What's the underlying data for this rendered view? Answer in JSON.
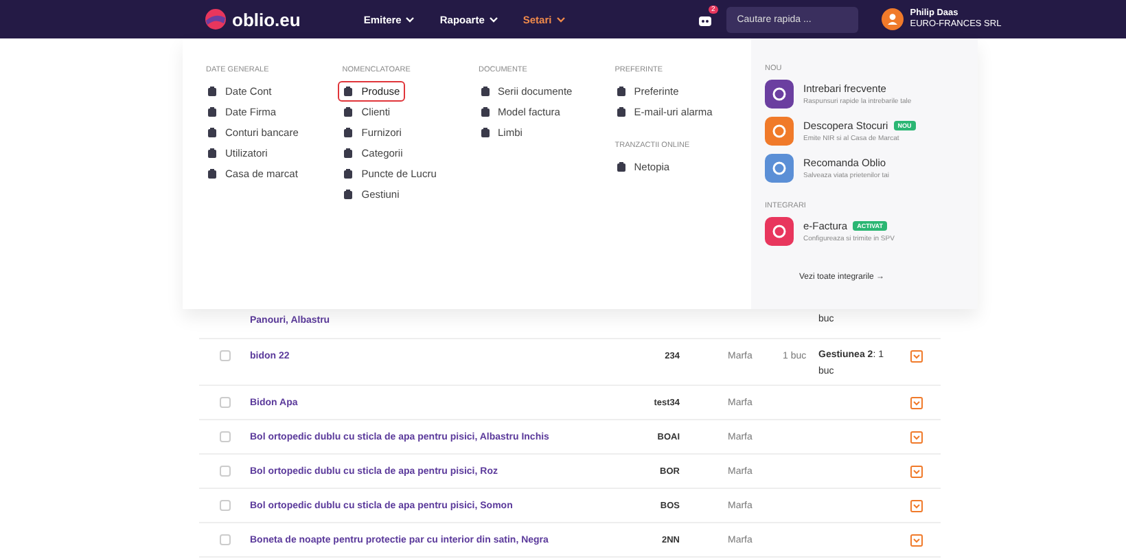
{
  "header": {
    "logo": "oblio.eu",
    "nav": [
      {
        "label": "Emitere",
        "selected": false
      },
      {
        "label": "Rapoarte",
        "selected": false
      },
      {
        "label": "Setari",
        "selected": true
      }
    ],
    "notifications": "2",
    "search": {
      "placeholder": "Cautare rapida ..."
    },
    "user": {
      "name": "Philip Daas",
      "company": "EURO-FRANCES SRL"
    }
  },
  "menu": {
    "columns": [
      {
        "sections": [
          {
            "title": "DATE GENERALE",
            "items": [
              {
                "label": "Date Cont",
                "selected": false
              },
              {
                "label": "Date Firma",
                "selected": false
              },
              {
                "label": "Conturi bancare",
                "selected": false
              },
              {
                "label": "Utilizatori",
                "selected": false
              },
              {
                "label": "Casa de marcat",
                "selected": false
              }
            ]
          }
        ]
      },
      {
        "sections": [
          {
            "title": "NOMENCLATOARE",
            "items": [
              {
                "label": "Produse",
                "selected": true
              },
              {
                "label": "Clienti",
                "selected": false
              },
              {
                "label": "Furnizori",
                "selected": false
              },
              {
                "label": "Categorii",
                "selected": false
              },
              {
                "label": "Puncte de Lucru",
                "selected": false
              },
              {
                "label": "Gestiuni",
                "selected": false
              }
            ]
          }
        ]
      },
      {
        "sections": [
          {
            "title": "DOCUMENTE",
            "items": [
              {
                "label": "Serii documente",
                "selected": false
              },
              {
                "label": "Model factura",
                "selected": false
              },
              {
                "label": "Limbi",
                "selected": false
              }
            ]
          }
        ]
      },
      {
        "sections": [
          {
            "title": "PREFERINTE",
            "items": [
              {
                "label": "Preferinte",
                "selected": false
              },
              {
                "label": "E-mail-uri alarma",
                "selected": false
              }
            ]
          },
          {
            "title": "TRANZACTII ONLINE",
            "items": [
              {
                "label": "Netopia",
                "selected": false
              }
            ]
          }
        ]
      }
    ],
    "side": [
      {
        "title": "NOU",
        "cards": [
          {
            "title": "Intrebari frecvente",
            "subtitle": "Raspunsuri rapide la intrebarile tale",
            "color": "#6b3fa0"
          },
          {
            "title": "Descopera Stocuri",
            "badge": "NOU",
            "subtitle": "Emite NIR si al Casa de Marcat",
            "color": "#f07a2a"
          },
          {
            "title": "Recomanda Oblio",
            "subtitle": "Salveaza viata prietenilor tai",
            "color": "#5b8fd6"
          }
        ]
      },
      {
        "title": "INTEGRARI",
        "cards": [
          {
            "title": "e-Factura",
            "badge": "ACTIVAT",
            "subtitle": "Configureaza si trimite in SPV",
            "color": "#e8365d"
          }
        ]
      }
    ],
    "all_link": "Vezi toate integrarile →"
  },
  "table": {
    "rows": [
      {
        "name": "Panouri, Albastru",
        "stock": "buc",
        "partial": true
      },
      {
        "name": "bidon 22",
        "checked": false,
        "code": "234",
        "type": "Marfa",
        "qty": "1 buc",
        "stock_label": "Gestiunea 2",
        "stock": ": 1 buc"
      },
      {
        "name": "Bidon Apa",
        "checked": false,
        "code": "test34",
        "type": "Marfa"
      },
      {
        "name": "Bol ortopedic dublu cu sticla de apa pentru pisici, Albastru Inchis",
        "checked": false,
        "code": "BOAI",
        "type": "Marfa"
      },
      {
        "name": "Bol ortopedic dublu cu sticla de apa pentru pisici, Roz",
        "checked": false,
        "code": "BOR",
        "type": "Marfa"
      },
      {
        "name": "Bol ortopedic dublu cu sticla de apa pentru pisici, Somon",
        "checked": false,
        "code": "BOS",
        "type": "Marfa"
      },
      {
        "name": "Boneta de noapte pentru protectie par cu interior din satin, Negra",
        "checked": false,
        "code": "2NN",
        "type": "Marfa"
      }
    ]
  }
}
